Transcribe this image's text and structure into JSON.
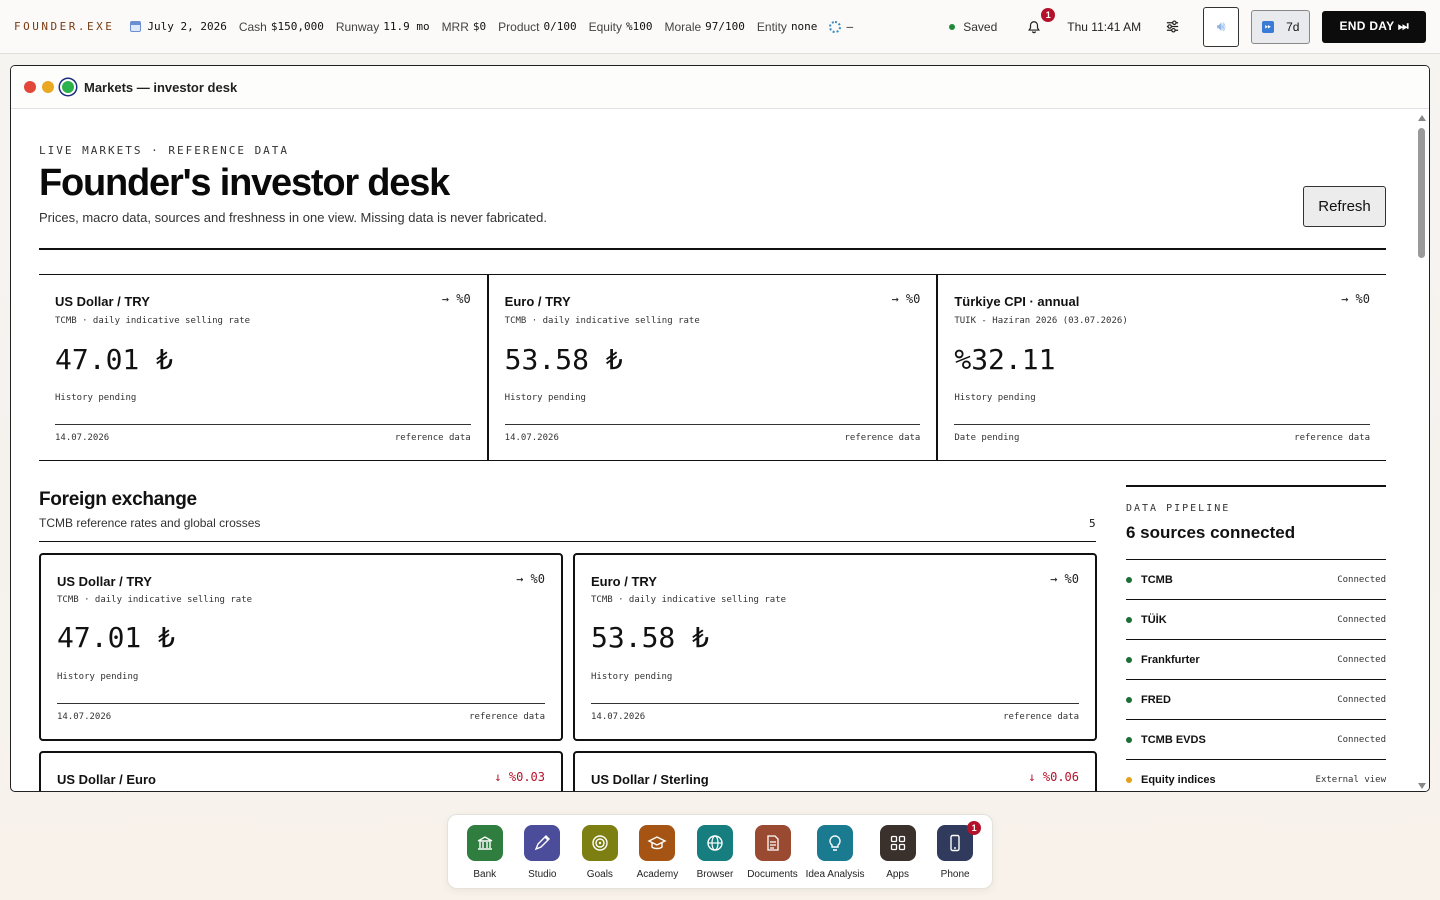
{
  "topbar": {
    "brand": "FOUNDER.EXE",
    "date": "July 2, 2026",
    "stats": [
      {
        "key": "Cash",
        "value": "$150,000"
      },
      {
        "key": "Runway",
        "value": "11.9 mo"
      },
      {
        "key": "MRR",
        "value": "$0"
      },
      {
        "key": "Product",
        "value": "0/100"
      },
      {
        "key": "Equity",
        "value": "%100"
      },
      {
        "key": "Morale",
        "value": "97/100"
      },
      {
        "key": "Entity",
        "value": "none"
      }
    ],
    "sync_value": "—",
    "saved_label": "Saved",
    "notification_count": "1",
    "clock": "Thu 11:41 AM",
    "speed_label": "7d",
    "end_day_label": "END DAY ⏭"
  },
  "window": {
    "title": "Markets — investor desk"
  },
  "header": {
    "eyebrow": "LIVE MARKETS · REFERENCE DATA",
    "title": "Founder's investor desk",
    "subtitle": "Prices, macro data, sources and freshness in one view. Missing data is never fabricated.",
    "refresh_label": "Refresh"
  },
  "top_cards": [
    {
      "name": "US Dollar / TRY",
      "source": "TCMB · daily indicative selling rate",
      "delta": "→ %0",
      "value": "47.01 ₺",
      "history": "History pending",
      "date": "14.07.2026",
      "tag": "reference data"
    },
    {
      "name": "Euro / TRY",
      "source": "TCMB · daily indicative selling rate",
      "delta": "→ %0",
      "value": "53.58 ₺",
      "history": "History pending",
      "date": "14.07.2026",
      "tag": "reference data"
    },
    {
      "name": "Türkiye CPI · annual",
      "source": "TUIK - Haziran 2026 (03.07.2026)",
      "delta": "→ %0",
      "value": "%32.11",
      "history": "History pending",
      "date": "Date pending",
      "tag": "reference data"
    }
  ],
  "fx": {
    "title": "Foreign exchange",
    "subtitle": "TCMB reference rates and global crosses",
    "count": "5",
    "cards": [
      {
        "name": "US Dollar / TRY",
        "source": "TCMB · daily indicative selling rate",
        "delta": "→ %0",
        "value": "47.01 ₺",
        "history": "History pending",
        "date": "14.07.2026",
        "tag": "reference data"
      },
      {
        "name": "Euro / TRY",
        "source": "TCMB · daily indicative selling rate",
        "delta": "→ %0",
        "value": "53.58 ₺",
        "history": "History pending",
        "date": "14.07.2026",
        "tag": "reference data"
      },
      {
        "name": "US Dollar / Euro",
        "delta": "↓ %0.03"
      },
      {
        "name": "US Dollar / Sterling",
        "delta": "↓ %0.06"
      }
    ]
  },
  "pipeline": {
    "eyebrow": "DATA PIPELINE",
    "title": "6 sources connected",
    "rows": [
      {
        "name": "TCMB",
        "status": "Connected",
        "state": "ok"
      },
      {
        "name": "TÜİK",
        "status": "Connected",
        "state": "ok"
      },
      {
        "name": "Frankfurter",
        "status": "Connected",
        "state": "ok"
      },
      {
        "name": "FRED",
        "status": "Connected",
        "state": "ok"
      },
      {
        "name": "TCMB EVDS",
        "status": "Connected",
        "state": "ok"
      },
      {
        "name": "Equity indices",
        "status": "External view",
        "state": "warn"
      }
    ]
  },
  "dock": {
    "items": [
      {
        "label": "Bank",
        "icon": "bank-icon",
        "color": "#2f7d3f"
      },
      {
        "label": "Studio",
        "icon": "pen-icon",
        "color": "#4b4c9a"
      },
      {
        "label": "Goals",
        "icon": "target-icon",
        "color": "#7d7f12"
      },
      {
        "label": "Academy",
        "icon": "graduation-cap-icon",
        "color": "#a55413"
      },
      {
        "label": "Browser",
        "icon": "globe-icon",
        "color": "#167e7e"
      },
      {
        "label": "Documents",
        "icon": "document-icon",
        "color": "#9b4a32"
      },
      {
        "label": "Idea Analysis",
        "icon": "lightbulb-icon",
        "color": "#1a7a90"
      },
      {
        "label": "Apps",
        "icon": "grid-icon",
        "color": "#3a302c"
      },
      {
        "label": "Phone",
        "icon": "phone-icon",
        "color": "#2f3a5c"
      }
    ],
    "phone_badge": "1"
  },
  "colors": {
    "accent_green": "#1f8a3a",
    "badge_red": "#b3122a",
    "negative": "#b3122a",
    "warn": "#e4a11b"
  }
}
